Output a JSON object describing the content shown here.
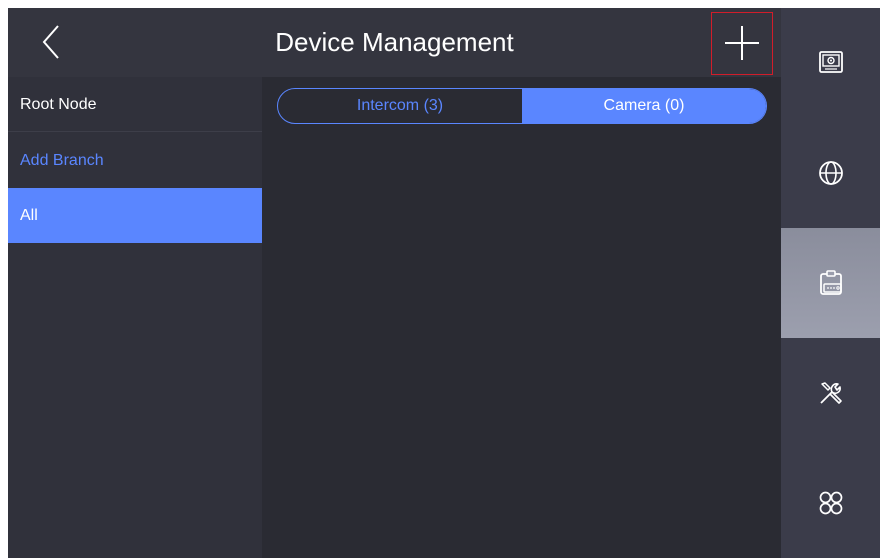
{
  "header": {
    "title": "Device Management",
    "back_icon": "chevron-left-icon",
    "add_icon": "plus-icon"
  },
  "tree": {
    "items": [
      {
        "label": "Root Node"
      },
      {
        "label": "Add Branch"
      },
      {
        "label": "All",
        "selected": true
      }
    ]
  },
  "tabs": [
    {
      "label": "Intercom (3)",
      "active": false
    },
    {
      "label": "Camera (0)",
      "active": true
    }
  ],
  "nav": {
    "items": [
      {
        "icon": "monitor-icon"
      },
      {
        "icon": "globe-icon"
      },
      {
        "icon": "device-management-icon",
        "selected": true
      },
      {
        "icon": "tools-icon"
      },
      {
        "icon": "apps-icon"
      }
    ]
  },
  "colors": {
    "accent": "#5a86ff",
    "highlight_border": "#d11d2a",
    "background": "#2a2b33"
  }
}
